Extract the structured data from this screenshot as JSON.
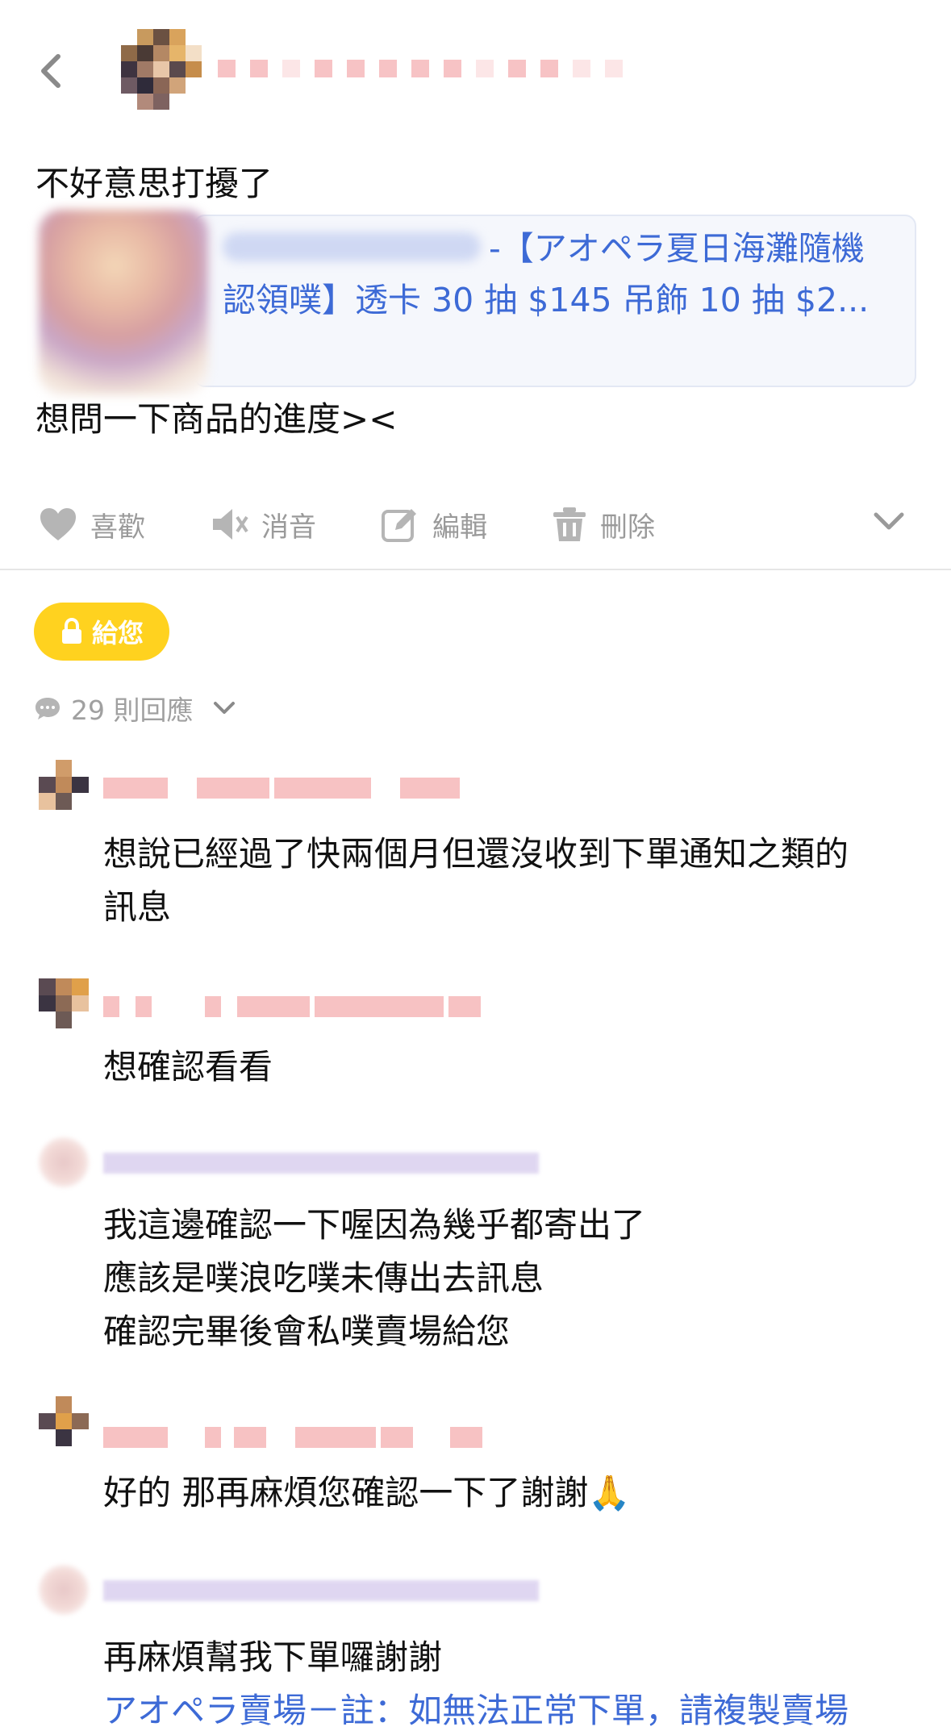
{
  "post": {
    "line1": "不好意思打擾了",
    "link_text_line1": "-【アオペラ夏日海灘隨機",
    "link_text_line2": "認領噗】透卡 30 抽 $145 吊飾 10 抽 $2...",
    "line2": "想問一下商品的進度><"
  },
  "actions": {
    "like": "喜歡",
    "mute": "消音",
    "edit": "編輯",
    "delete": "刪除"
  },
  "badge": {
    "label": "給您"
  },
  "replies": {
    "count_label": "29 則回應"
  },
  "comments": [
    {
      "lines": [
        "想說已經過了快兩個月但還沒收到下單通知之類的",
        "訊息"
      ]
    },
    {
      "lines": [
        "想確認看看"
      ]
    },
    {
      "lines": [
        "我這邊確認一下喔因為幾乎都寄出了",
        "應該是噗浪吃噗未傳出去訊息",
        "確認完畢後會私噗賣場給您"
      ]
    },
    {
      "lines": [
        "好的 那再麻煩您確認一下了謝謝🙏"
      ]
    },
    {
      "lines": [
        "再麻煩幫我下單囉謝謝"
      ],
      "link": "アオペラ賣場－註：如無法正常下單，請複製賣場"
    }
  ],
  "colors": {
    "link": "#3d6ad6",
    "badge": "#ffd21f",
    "muted": "#9a9a9a"
  },
  "icons": {
    "back": "chevron-left-icon",
    "like": "heart-icon",
    "mute": "speaker-mute-icon",
    "edit": "pencil-square-icon",
    "delete": "trash-icon",
    "more": "chevron-down-icon",
    "badge": "lock-icon",
    "replies": "speech-bubble-icon"
  }
}
